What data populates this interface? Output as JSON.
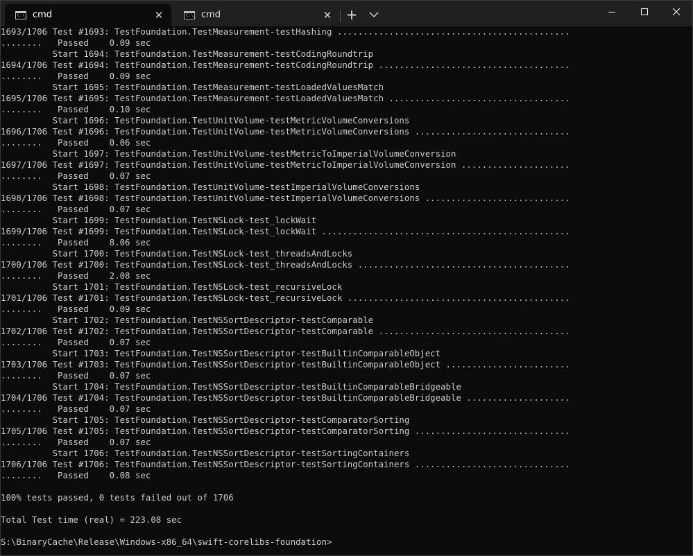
{
  "tabs": [
    {
      "title": "cmd",
      "active": true,
      "icon": "cmd-icon",
      "close_label": "✕"
    },
    {
      "title": "cmd",
      "active": false,
      "icon": "cmd-icon",
      "close_label": "✕"
    }
  ],
  "titlebar": {
    "new_tab_label": "+",
    "icon_text": "C:\\_"
  },
  "colors": {
    "titlebar_bg": "#202020",
    "terminal_bg": "#0c0c0c",
    "terminal_fg": "#cccccc"
  },
  "terminal_lines": [
    "1693/1706 Test #1693: TestFoundation.TestMeasurement-testHashing .............................................",
    "........   Passed    0.09 sec",
    "          Start 1694: TestFoundation.TestMeasurement-testCodingRoundtrip",
    "1694/1706 Test #1694: TestFoundation.TestMeasurement-testCodingRoundtrip .....................................",
    "........   Passed    0.09 sec",
    "          Start 1695: TestFoundation.TestMeasurement-testLoadedValuesMatch",
    "1695/1706 Test #1695: TestFoundation.TestMeasurement-testLoadedValuesMatch ...................................",
    "........   Passed    0.10 sec",
    "          Start 1696: TestFoundation.TestUnitVolume-testMetricVolumeConversions",
    "1696/1706 Test #1696: TestFoundation.TestUnitVolume-testMetricVolumeConversions ..............................",
    "........   Passed    0.06 sec",
    "          Start 1697: TestFoundation.TestUnitVolume-testMetricToImperialVolumeConversion",
    "1697/1706 Test #1697: TestFoundation.TestUnitVolume-testMetricToImperialVolumeConversion .....................",
    "........   Passed    0.07 sec",
    "          Start 1698: TestFoundation.TestUnitVolume-testImperialVolumeConversions",
    "1698/1706 Test #1698: TestFoundation.TestUnitVolume-testImperialVolumeConversions ............................",
    "........   Passed    0.07 sec",
    "          Start 1699: TestFoundation.TestNSLock-test_lockWait",
    "1699/1706 Test #1699: TestFoundation.TestNSLock-test_lockWait ................................................",
    "........   Passed    8.06 sec",
    "          Start 1700: TestFoundation.TestNSLock-test_threadsAndLocks",
    "1700/1706 Test #1700: TestFoundation.TestNSLock-test_threadsAndLocks .........................................",
    "........   Passed    2.08 sec",
    "          Start 1701: TestFoundation.TestNSLock-test_recursiveLock",
    "1701/1706 Test #1701: TestFoundation.TestNSLock-test_recursiveLock ...........................................",
    "........   Passed    0.09 sec",
    "          Start 1702: TestFoundation.TestNSSortDescriptor-testComparable",
    "1702/1706 Test #1702: TestFoundation.TestNSSortDescriptor-testComparable .....................................",
    "........   Passed    0.07 sec",
    "          Start 1703: TestFoundation.TestNSSortDescriptor-testBuiltinComparableObject",
    "1703/1706 Test #1703: TestFoundation.TestNSSortDescriptor-testBuiltinComparableObject ........................",
    "........   Passed    0.07 sec",
    "          Start 1704: TestFoundation.TestNSSortDescriptor-testBuiltinComparableBridgeable",
    "1704/1706 Test #1704: TestFoundation.TestNSSortDescriptor-testBuiltinComparableBridgeable ....................",
    "........   Passed    0.07 sec",
    "          Start 1705: TestFoundation.TestNSSortDescriptor-testComparatorSorting",
    "1705/1706 Test #1705: TestFoundation.TestNSSortDescriptor-testComparatorSorting ..............................",
    "........   Passed    0.07 sec",
    "          Start 1706: TestFoundation.TestNSSortDescriptor-testSortingContainers",
    "1706/1706 Test #1706: TestFoundation.TestNSSortDescriptor-testSortingContainers ..............................",
    "........   Passed    0.08 sec",
    "",
    "100% tests passed, 0 tests failed out of 1706",
    "",
    "Total Test time (real) = 223.08 sec",
    "",
    "S:\\BinaryCache\\Release\\Windows-x86_64\\swift-corelibs-foundation>"
  ]
}
